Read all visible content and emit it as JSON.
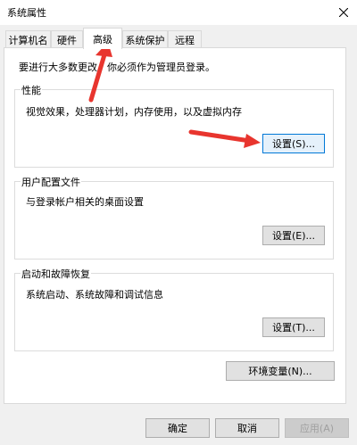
{
  "window": {
    "title": "系统属性"
  },
  "tabs": [
    {
      "label": "计算机名"
    },
    {
      "label": "硬件"
    },
    {
      "label": "高级"
    },
    {
      "label": "系统保护"
    },
    {
      "label": "远程"
    }
  ],
  "admin_note": "要进行大多数更改，你必须作为管理员登录。",
  "performance": {
    "label": "性能",
    "description": "视觉效果，处理器计划，内存使用，以及虚拟内存",
    "button": "设置(S)..."
  },
  "user_profiles": {
    "label": "用户配置文件",
    "description": "与登录帐户相关的桌面设置",
    "button": "设置(E)..."
  },
  "startup_recovery": {
    "label": "启动和故障恢复",
    "description": "系统启动、系统故障和调试信息",
    "button": "设置(T)..."
  },
  "env_button": "环境变量(N)...",
  "footer": {
    "ok": "确定",
    "cancel": "取消",
    "apply": "应用(A)"
  },
  "annotation_color": "#e8352e"
}
